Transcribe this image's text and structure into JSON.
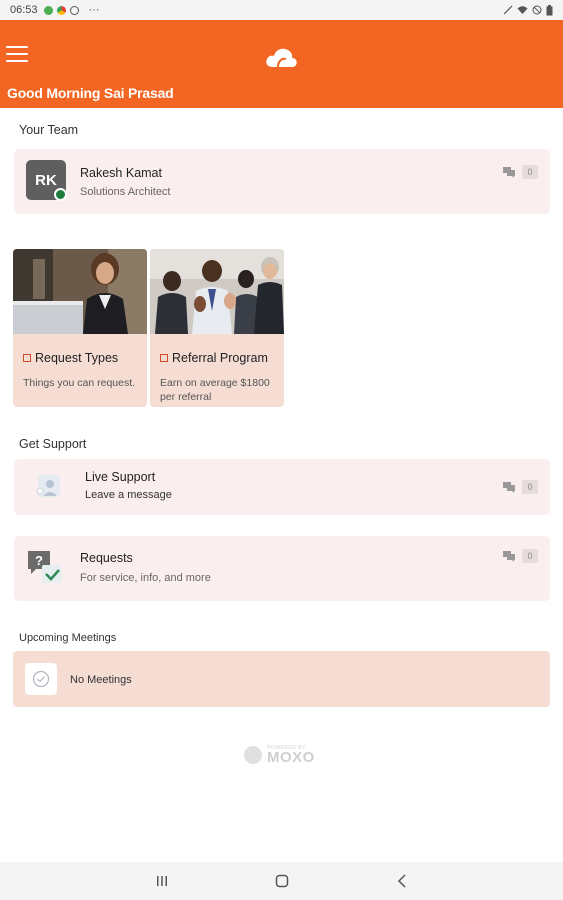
{
  "status_bar": {
    "time": "06:53",
    "more": "···"
  },
  "header": {
    "greeting": "Good Morning Sai Prasad",
    "brand_color": "#f26522"
  },
  "team": {
    "section_title": "Your Team",
    "member": {
      "initials": "RK",
      "name": "Rakesh Kamat",
      "role": "Solutions Architect",
      "unread_count": "0"
    }
  },
  "tiles": [
    {
      "title": "Request Types",
      "description": "Things you can request."
    },
    {
      "title": "Referral Program",
      "description": "Earn on average $1800 per referral"
    }
  ],
  "support": {
    "section_title": "Get Support",
    "live": {
      "title": "Live Support",
      "subtitle": "Leave a message",
      "unread_count": "0"
    },
    "requests": {
      "title": "Requests",
      "subtitle": "For service, info, and more",
      "unread_count": "0"
    }
  },
  "meetings": {
    "section_title": "Upcoming Meetings",
    "empty_text": "No Meetings"
  },
  "footer": {
    "powered_by": "POWERED BY",
    "brand": "MOXO"
  }
}
